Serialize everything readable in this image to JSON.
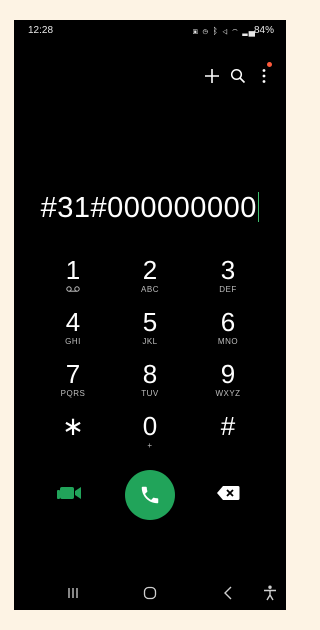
{
  "status_bar": {
    "time": "12:28",
    "battery_percent": "84%",
    "icons": [
      "sim-icon",
      "alarm-icon",
      "bluetooth-icon",
      "mute-icon",
      "wifi-icon",
      "signal-icon",
      "battery-icon"
    ]
  },
  "toolbar": {
    "icons": [
      "add-icon",
      "search-icon",
      "more-options-icon"
    ],
    "notification_dot_color": "#ff5a3c"
  },
  "dialer": {
    "entered_number": "#31#000000000",
    "cursor_color": "#3fbf6f"
  },
  "keypad": {
    "keys": [
      {
        "digit": "1",
        "letters": ""
      },
      {
        "digit": "2",
        "letters": "ABC"
      },
      {
        "digit": "3",
        "letters": "DEF"
      },
      {
        "digit": "4",
        "letters": "GHI"
      },
      {
        "digit": "5",
        "letters": "JKL"
      },
      {
        "digit": "6",
        "letters": "MNO"
      },
      {
        "digit": "7",
        "letters": "PQRS"
      },
      {
        "digit": "8",
        "letters": "TUV"
      },
      {
        "digit": "9",
        "letters": "WXYZ"
      },
      {
        "digit": "∗",
        "letters": ""
      },
      {
        "digit": "0",
        "letters": "+"
      },
      {
        "digit": "#",
        "letters": ""
      }
    ]
  },
  "actions": {
    "video_icon": "video-call-icon",
    "call_icon": "phone-icon",
    "backspace_icon": "backspace-icon",
    "accent_color": "#21a45a"
  },
  "nav_bar": {
    "icons": [
      "recent-apps-icon",
      "home-icon",
      "back-icon",
      "accessibility-icon"
    ]
  }
}
